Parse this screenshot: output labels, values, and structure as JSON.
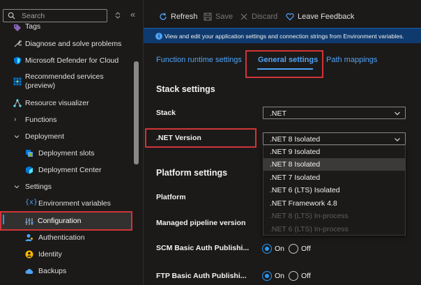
{
  "sidebar": {
    "search": {
      "placeholder": "Search"
    },
    "items": [
      {
        "label": "Tags"
      },
      {
        "label": "Diagnose and solve problems"
      },
      {
        "label": "Microsoft Defender for Cloud"
      },
      {
        "label": "Recommended services",
        "label2": "(preview)"
      },
      {
        "label": "Resource visualizer"
      },
      {
        "label": "Functions"
      },
      {
        "label": "Deployment"
      },
      {
        "label": "Deployment slots"
      },
      {
        "label": "Deployment Center"
      },
      {
        "label": "Settings"
      },
      {
        "label": "Environment variables"
      },
      {
        "label": "Configuration"
      },
      {
        "label": "Authentication"
      },
      {
        "label": "Identity"
      },
      {
        "label": "Backups"
      }
    ]
  },
  "toolbar": {
    "refresh": "Refresh",
    "save": "Save",
    "discard": "Discard",
    "feedback": "Leave Feedback"
  },
  "info": {
    "text": "View and edit your application settings and connection strings from Environment variables."
  },
  "tabs": [
    {
      "label": "Function runtime settings"
    },
    {
      "label": "General settings"
    },
    {
      "label": "Path mappings"
    }
  ],
  "stack_settings": {
    "title": "Stack settings",
    "stack_label": "Stack",
    "stack_value": ".NET",
    "version_label": ".NET Version",
    "version_value": ".NET 8 Isolated",
    "options": [
      {
        "label": ".NET 9 Isolated"
      },
      {
        "label": ".NET 8 Isolated"
      },
      {
        "label": ".NET 7 Isolated"
      },
      {
        "label": ".NET 6 (LTS) Isolated"
      },
      {
        "label": ".NET Framework 4.8"
      },
      {
        "label": ".NET 8 (LTS) In-process"
      },
      {
        "label": ".NET 6 (LTS) In-process"
      }
    ]
  },
  "platform_settings": {
    "title": "Platform settings",
    "platform_label": "Platform",
    "pipeline_label": "Managed pipeline version",
    "scm_label": "SCM Basic Auth Publishi...",
    "ftp_label": "FTP Basic Auth Publishi...",
    "on": "On",
    "off": "Off"
  },
  "colors": {
    "accent": "#2899f5",
    "highlight_border": "#d13438",
    "info_bar": "#0f3a6e"
  }
}
